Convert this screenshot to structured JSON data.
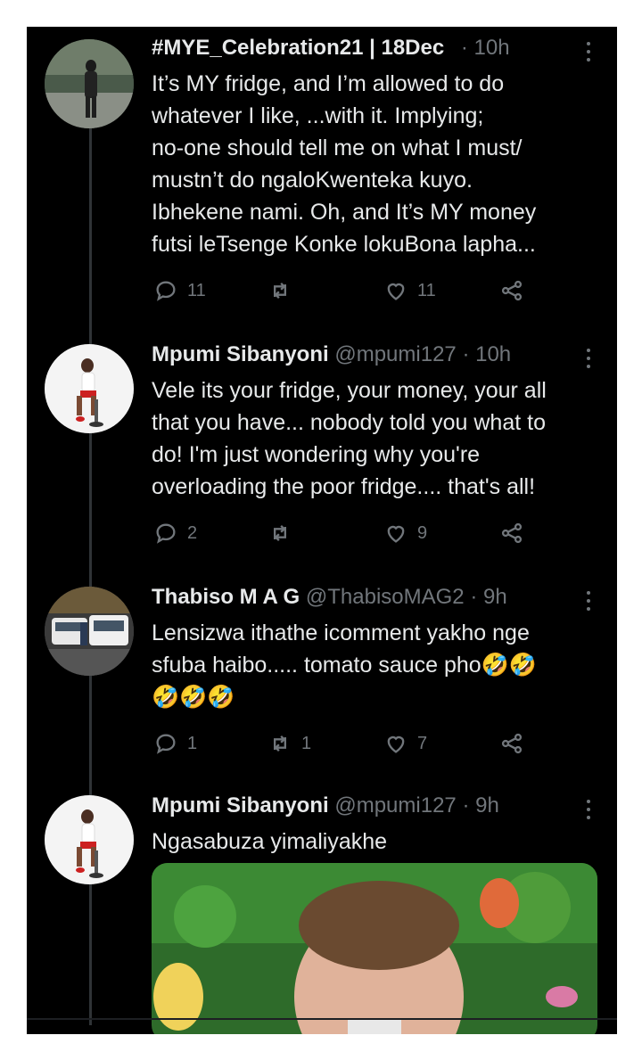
{
  "tweets": [
    {
      "name": "#MYE_Celebration21 | 18Dec",
      "handle": "",
      "time": "· 10h",
      "text": "It’s MY fridge, and I’m allowed to do\nwhatever I like, ...with it. Implying;\nno-one should tell me on what I must/\nmustn’t do ngaloKwenteka kuyo.\nIbhekene nami. Oh, and It’s MY money\nfutsi leTsenge Konke lokuBona lapha...",
      "replies": "11",
      "retweets": "",
      "likes": "11"
    },
    {
      "name": "Mpumi Sibanyoni",
      "handle": "@mpumi127",
      "time": "· 10h",
      "text": "Vele its your fridge, your money, your all\nthat you have... nobody told you what to\ndo! I'm just wondering why you're\noverloading the poor fridge.... that's all!",
      "replies": "2",
      "retweets": "",
      "likes": "9"
    },
    {
      "name": "Thabiso M A G",
      "handle": "@ThabisoMAG2",
      "time": "· 9h",
      "text": "Lensizwa ithathe icomment yakho nge\nsfuba haibo..... tomato sauce pho🤣🤣\n🤣🤣🤣",
      "replies": "1",
      "retweets": "1",
      "likes": "7"
    },
    {
      "name": "Mpumi Sibanyoni",
      "handle": "@mpumi127",
      "time": "· 9h",
      "text": "Ngasabuza yimaliyakhe",
      "replies": "",
      "retweets": "",
      "likes": ""
    }
  ],
  "icons": {
    "reply": "reply-icon",
    "retweet": "retweet-icon",
    "like": "heart-icon",
    "share": "share-icon",
    "more": "more-icon"
  },
  "colors": {
    "background": "#000000",
    "text": "#e7e9ea",
    "muted": "#71767b"
  }
}
